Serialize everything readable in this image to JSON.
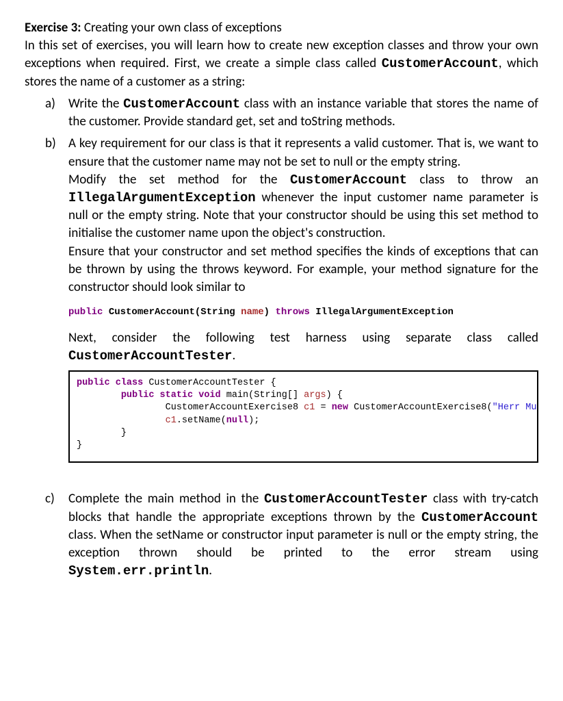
{
  "exercise": {
    "title_bold": "Exercise 3:",
    "title_rest": " Creating your own class of exceptions",
    "intro_pre": "In this set of exercises, you will learn how to create new exception classes and throw your own exceptions when required. First, we create a simple class called ",
    "intro_code": "CustomerAccount",
    "intro_post": ", which stores the name of a customer as a string:"
  },
  "items": {
    "a": {
      "marker": "a)",
      "t1": "Write the ",
      "c1": "CustomerAccount",
      "t2": " class with an instance variable that stores the name of the customer. Provide standard get, set and toString methods."
    },
    "b": {
      "marker": "b)",
      "p1_t1": "A key requirement for our class is that it represents a valid customer. That is, we want to ensure that the customer name may not be set to null or the empty string.",
      "p2_t1": "Modify the set method for the ",
      "p2_c1": "CustomerAccount",
      "p2_t2": " class to throw an ",
      "p2_c2": "IllegalArgumentException",
      "p2_t3": " whenever the input customer name parameter is null or the empty string. Note that your constructor should be using this set method to initialise the customer name upon the object's construction.",
      "p3": "Ensure that your constructor and set method specifies the kinds of exceptions that can be thrown by using the throws keyword. For example, your method signature for the constructor should look similar to",
      "sig": {
        "kw1": "public",
        "sp1": " CustomerAccount(String ",
        "par": "name",
        "sp2": ") ",
        "kw2": "throws",
        "sp3": " IllegalArgumentException"
      },
      "p4_t1": "Next, consider the following test harness using separate class called ",
      "p4_c1": "CustomerAccountTester",
      "p4_t2": "."
    },
    "c": {
      "marker": "c)",
      "t1": "Complete the main method in the ",
      "c1": "CustomerAccountTester",
      "t2": " class with try-catch blocks that handle the appropriate exceptions thrown by the ",
      "c2": "CustomerAccount",
      "t3": " class. When the setName or constructor input parameter is null or the empty string, the exception thrown should be printed to the error stream using ",
      "c3": "System.err.println",
      "t4": "."
    }
  },
  "codebox": {
    "l1": {
      "kw1": "public class",
      "t1": " CustomerAccountTester {"
    },
    "l2": {
      "pad": "        ",
      "kw1": "public static void",
      "t1": " main(String[] ",
      "par": "args",
      "t2": ") {"
    },
    "l3": {
      "pad": "                ",
      "t1": "CustomerAccountExercise8 ",
      "par1": "c1",
      "t2": " = ",
      "kw1": "new",
      "t3": " CustomerAccountExercise8(",
      "str": "\"Herr Mustermann\"",
      "t4": ");"
    },
    "l4": {
      "pad": "                ",
      "par1": "c1",
      "t1": ".setName(",
      "kw1": "null",
      "t2": ");"
    },
    "l5": {
      "pad": "        ",
      "t1": "}"
    },
    "l6": {
      "t1": "}"
    }
  }
}
